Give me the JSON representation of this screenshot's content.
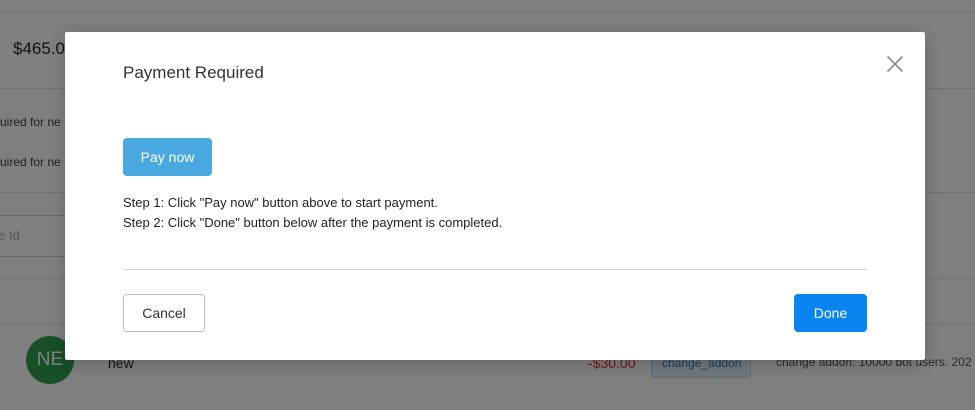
{
  "background": {
    "price": "$465.0",
    "note_1": "uired for ne",
    "note_2": "uired for ne",
    "input_placeholder": "e Id",
    "row": {
      "avatar_initials": "NE",
      "name": "new",
      "amount": "-$30.00",
      "tag": "change_addon",
      "description": "change addon: 10000 bot users. 202"
    }
  },
  "modal": {
    "title": "Payment Required",
    "close_icon": "close-icon",
    "pay_button_label": "Pay now",
    "step_1": "Step 1: Click \"Pay now\" button above to start payment.",
    "step_2": "Step 2: Click \"Done\" button below after the payment is completed.",
    "cancel_button_label": "Cancel",
    "done_button_label": "Done"
  },
  "colors": {
    "pay_button": "#4aa8e0",
    "done_button": "#0a84f0",
    "amount_negative": "#e0282e",
    "avatar": "#2e9e4f"
  }
}
